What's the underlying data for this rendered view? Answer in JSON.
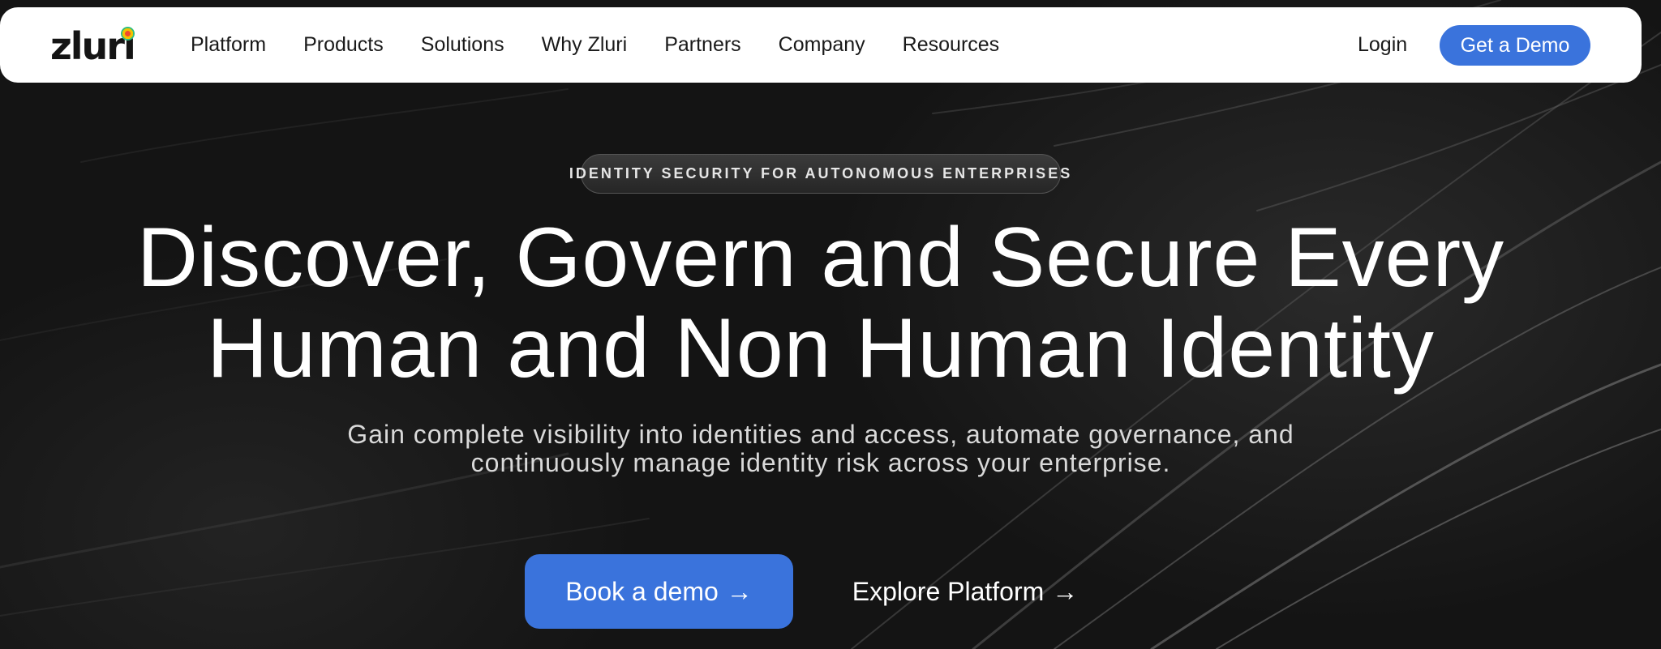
{
  "brand": {
    "name": "zluri"
  },
  "nav": {
    "links": [
      "Platform",
      "Products",
      "Solutions",
      "Why Zluri",
      "Partners",
      "Company",
      "Resources"
    ],
    "login_label": "Login",
    "cta_label": "Get a Demo"
  },
  "hero": {
    "badge": "IDENTITY SECURITY FOR AUTONOMOUS ENTERPRISES",
    "headline_line1": "Discover, Govern and Secure Every",
    "headline_line2": "Human and Non Human Identity",
    "subtitle_line1": "Gain complete visibility into identities and access, automate governance, and",
    "subtitle_line2": "continuously manage identity risk across your enterprise.",
    "primary_cta": "Book a demo",
    "secondary_cta": "Explore Platform",
    "arrow_glyph": "→"
  },
  "colors": {
    "accent": "#3a73dc",
    "background": "#141414",
    "navbar": "#ffffff"
  }
}
